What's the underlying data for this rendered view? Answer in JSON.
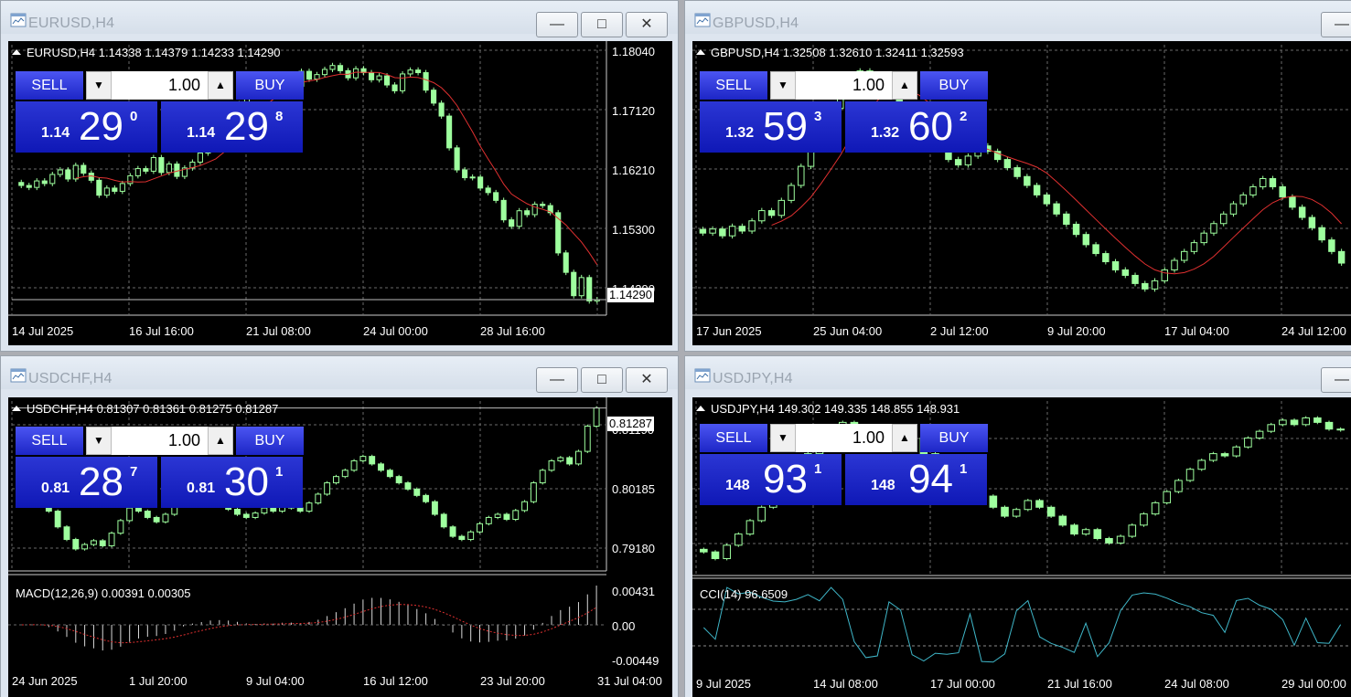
{
  "windows": [
    {
      "key": "eurusd",
      "title": "EURUSD,H4",
      "header": "EURUSD,H4  1.14338 1.14379 1.14233 1.14290",
      "trade": {
        "sell": "SELL",
        "buy": "BUY",
        "lot": "1.00",
        "sell_big": "1.14",
        "sell_pips": "29",
        "sell_frac": "0",
        "buy_big": "1.14",
        "buy_pips": "29",
        "buy_frac": "8"
      },
      "price_axis": [
        "1.18040",
        "1.17120",
        "1.16210",
        "1.15300",
        "1.14390"
      ],
      "current_price": "1.14290",
      "time_axis": [
        "14 Jul 2025",
        "16 Jul 16:00",
        "21 Jul 08:00",
        "24 Jul 00:00",
        "28 Jul 16:00"
      ],
      "chart_data": {
        "type": "candlestick",
        "ylim": [
          1.1405,
          1.1822
        ],
        "closes": [
          1.1605,
          1.1602,
          1.1612,
          1.1608,
          1.1622,
          1.1629,
          1.1615,
          1.1636,
          1.1624,
          1.1613,
          1.159,
          1.1601,
          1.1596,
          1.1608,
          1.162,
          1.1631,
          1.1627,
          1.1648,
          1.1625,
          1.1638,
          1.1619,
          1.1632,
          1.1641,
          1.1655,
          1.1668,
          1.169,
          1.1703,
          1.1716,
          1.1731,
          1.1747,
          1.1762,
          1.1755,
          1.177,
          1.1764,
          1.1772,
          1.1758,
          1.1781,
          1.1769,
          1.1776,
          1.1784,
          1.179,
          1.1782,
          1.1771,
          1.1785,
          1.1779,
          1.1768,
          1.1774,
          1.176,
          1.1751,
          1.1777,
          1.1783,
          1.1779,
          1.1752,
          1.1732,
          1.1712,
          1.1663,
          1.1629,
          1.1617,
          1.1618,
          1.1601,
          1.1594,
          1.1582,
          1.1552,
          1.1542,
          1.1566,
          1.156,
          1.1576,
          1.1574,
          1.1563,
          1.1501,
          1.1471,
          1.1435,
          1.1463,
          1.1427,
          1.1429
        ],
        "ma_color": "#e03030",
        "up_color": "#9eff9e"
      }
    },
    {
      "key": "gbpusd",
      "title": "GBPUSD,H4",
      "header": "GBPUSD,H4  1.32508 1.32610 1.32411 1.32593",
      "trade": {
        "sell": "SELL",
        "buy": "BUY",
        "lot": "1.00",
        "sell_big": "1.32",
        "sell_pips": "59",
        "sell_frac": "3",
        "buy_big": "1.32",
        "buy_pips": "60",
        "buy_frac": "2"
      },
      "time_axis": [
        "17 Jun 2025",
        "25 Jun 04:00",
        "2 Jul 12:00",
        "9 Jul 20:00",
        "17 Jul 04:00",
        "24 Jul 12:00"
      ],
      "chart_data": {
        "type": "candlestick",
        "closes": [
          1.3542,
          1.3548,
          1.3538,
          1.3552,
          1.3545,
          1.356,
          1.3575,
          1.3568,
          1.359,
          1.3612,
          1.364,
          1.3668,
          1.37,
          1.3725,
          1.3748,
          1.3765,
          1.378,
          1.3772,
          1.376,
          1.3745,
          1.3728,
          1.371,
          1.3696,
          1.368,
          1.3665,
          1.365,
          1.3642,
          1.3655,
          1.367,
          1.3662,
          1.365,
          1.3638,
          1.3625,
          1.3612,
          1.3598,
          1.3585,
          1.357,
          1.3555,
          1.354,
          1.3525,
          1.3512,
          1.35,
          1.3488,
          1.348,
          1.3468,
          1.346,
          1.3472,
          1.3488,
          1.3502,
          1.3515,
          1.3528,
          1.3542,
          1.3556,
          1.357,
          1.3585,
          1.3598,
          1.361,
          1.3622,
          1.361,
          1.3595,
          1.358,
          1.3565,
          1.355,
          1.3532,
          1.3515,
          1.3498
        ],
        "ma_color": "#e03030",
        "up_color": "#9eff9e"
      }
    },
    {
      "key": "usdchf",
      "title": "USDCHF,H4",
      "header": "USDCHF,H4  0.81307 0.81361 0.81275 0.81287",
      "trade": {
        "sell": "SELL",
        "buy": "BUY",
        "lot": "1.00",
        "sell_big": "0.81",
        "sell_pips": "28",
        "sell_frac": "7",
        "buy_big": "0.81",
        "buy_pips": "30",
        "buy_frac": "1"
      },
      "price_axis": [
        "0.81190",
        "0.80185",
        "0.79180"
      ],
      "current_price": "0.81287",
      "time_axis": [
        "24 Jun 2025",
        "1 Jul 20:00",
        "9 Jul 04:00",
        "16 Jul 12:00",
        "23 Jul 20:00",
        "31 Jul 04:00"
      ],
      "macd": {
        "label": "MACD(12,26,9) 0.00391 0.00305",
        "axis": [
          "0.00431",
          "0.00",
          "-0.00449"
        ]
      },
      "chart_data": {
        "type": "candlestick",
        "ylim": [
          0.787,
          0.814
        ],
        "closes": [
          0.7985,
          0.799,
          0.798,
          0.7965,
          0.794,
          0.792,
          0.7905,
          0.7912,
          0.7918,
          0.791,
          0.793,
          0.795,
          0.797,
          0.7965,
          0.7955,
          0.7948,
          0.796,
          0.7975,
          0.799,
          0.7985,
          0.7978,
          0.7982,
          0.7975,
          0.7968,
          0.796,
          0.7955,
          0.7962,
          0.797,
          0.7965,
          0.7975,
          0.797,
          0.7965,
          0.7978,
          0.7992,
          0.801,
          0.802,
          0.803,
          0.8045,
          0.8052,
          0.804,
          0.803,
          0.802,
          0.801,
          0.8,
          0.799,
          0.798,
          0.796,
          0.794,
          0.7925,
          0.792,
          0.7932,
          0.7945,
          0.7955,
          0.796,
          0.7952,
          0.7966,
          0.798,
          0.801,
          0.803,
          0.8045,
          0.805,
          0.804,
          0.806,
          0.81,
          0.8129
        ],
        "ma_color": "#e03030",
        "up_color": "#9eff9e"
      }
    },
    {
      "key": "usdjpy",
      "title": "USDJPY,H4",
      "header": "USDJPY,H4  149.302 149.335 148.855 148.931",
      "trade": {
        "sell": "SELL",
        "buy": "BUY",
        "lot": "1.00",
        "sell_big": "148",
        "sell_pips": "93",
        "sell_frac": "1",
        "buy_big": "148",
        "buy_pips": "94",
        "buy_frac": "1"
      },
      "time_axis": [
        "9 Jul 2025",
        "14 Jul 08:00",
        "17 Jul 00:00",
        "21 Jul 16:00",
        "24 Jul 08:00",
        "29 Jul 00:00"
      ],
      "cci": {
        "label": "CCI(14) 96.6509"
      },
      "chart_data": {
        "type": "candlestick",
        "closes": [
          146.2,
          146.05,
          146.35,
          146.6,
          146.9,
          147.2,
          147.5,
          147.8,
          148.1,
          148.4,
          148.6,
          148.9,
          149.1,
          148.95,
          148.7,
          148.5,
          148.8,
          149.0,
          148.75,
          148.4,
          148.1,
          147.8,
          147.55,
          147.7,
          147.45,
          147.2,
          147.0,
          147.15,
          147.35,
          147.2,
          147.0,
          146.8,
          146.6,
          146.7,
          146.5,
          146.4,
          146.55,
          146.8,
          147.05,
          147.3,
          147.55,
          147.8,
          148.05,
          148.25,
          148.4,
          148.35,
          148.55,
          148.75,
          148.9,
          149.05,
          149.15,
          149.05,
          149.2,
          149.1,
          148.95,
          148.93
        ],
        "up_color": "#9eff9e"
      }
    }
  ]
}
